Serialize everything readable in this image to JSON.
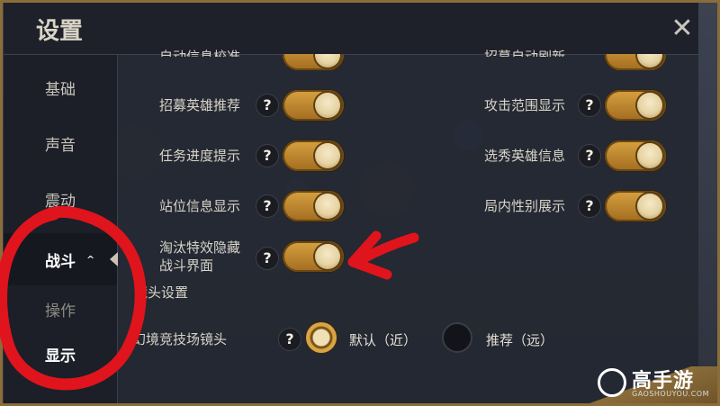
{
  "window": {
    "title": "设置",
    "close_label": "✕"
  },
  "sidebar": {
    "items": [
      {
        "label": "基础",
        "active": false
      },
      {
        "label": "声音",
        "active": false
      },
      {
        "label": "震动",
        "active": false
      },
      {
        "label": "战斗",
        "active": true,
        "expanded": true,
        "chevron": "^"
      },
      {
        "label": "操作",
        "active": false
      },
      {
        "label": "显示",
        "active": true
      }
    ]
  },
  "settings": {
    "partial_top_left": "自动信息校准",
    "partial_top_right": "招募自动刷新",
    "left": [
      {
        "label": "招募英雄推荐",
        "on": true
      },
      {
        "label": "任务进度提示",
        "on": true
      },
      {
        "label": "站位信息显示",
        "on": true
      },
      {
        "label_line1": "淘汰特效隐藏",
        "label_line2": "战斗界面",
        "on": true
      }
    ],
    "right": [
      {
        "label": "攻击范围显示",
        "on": true
      },
      {
        "label": "选秀英雄信息",
        "on": true
      },
      {
        "label": "局内性别展示",
        "on": true
      }
    ],
    "help_label": "?"
  },
  "camera": {
    "section_title": "镜头设置",
    "row_label": "幻境竞技场镜头",
    "options": [
      {
        "label": "默认（近）",
        "selected": true
      },
      {
        "label": "推荐（远）",
        "selected": false
      }
    ]
  },
  "watermark": {
    "name": "高手游",
    "url": "GAOSHOUYOU.COM"
  },
  "colors": {
    "accent_gold": "#d7a140",
    "annotation_red": "#e0141c",
    "panel_bg": "#242832"
  }
}
